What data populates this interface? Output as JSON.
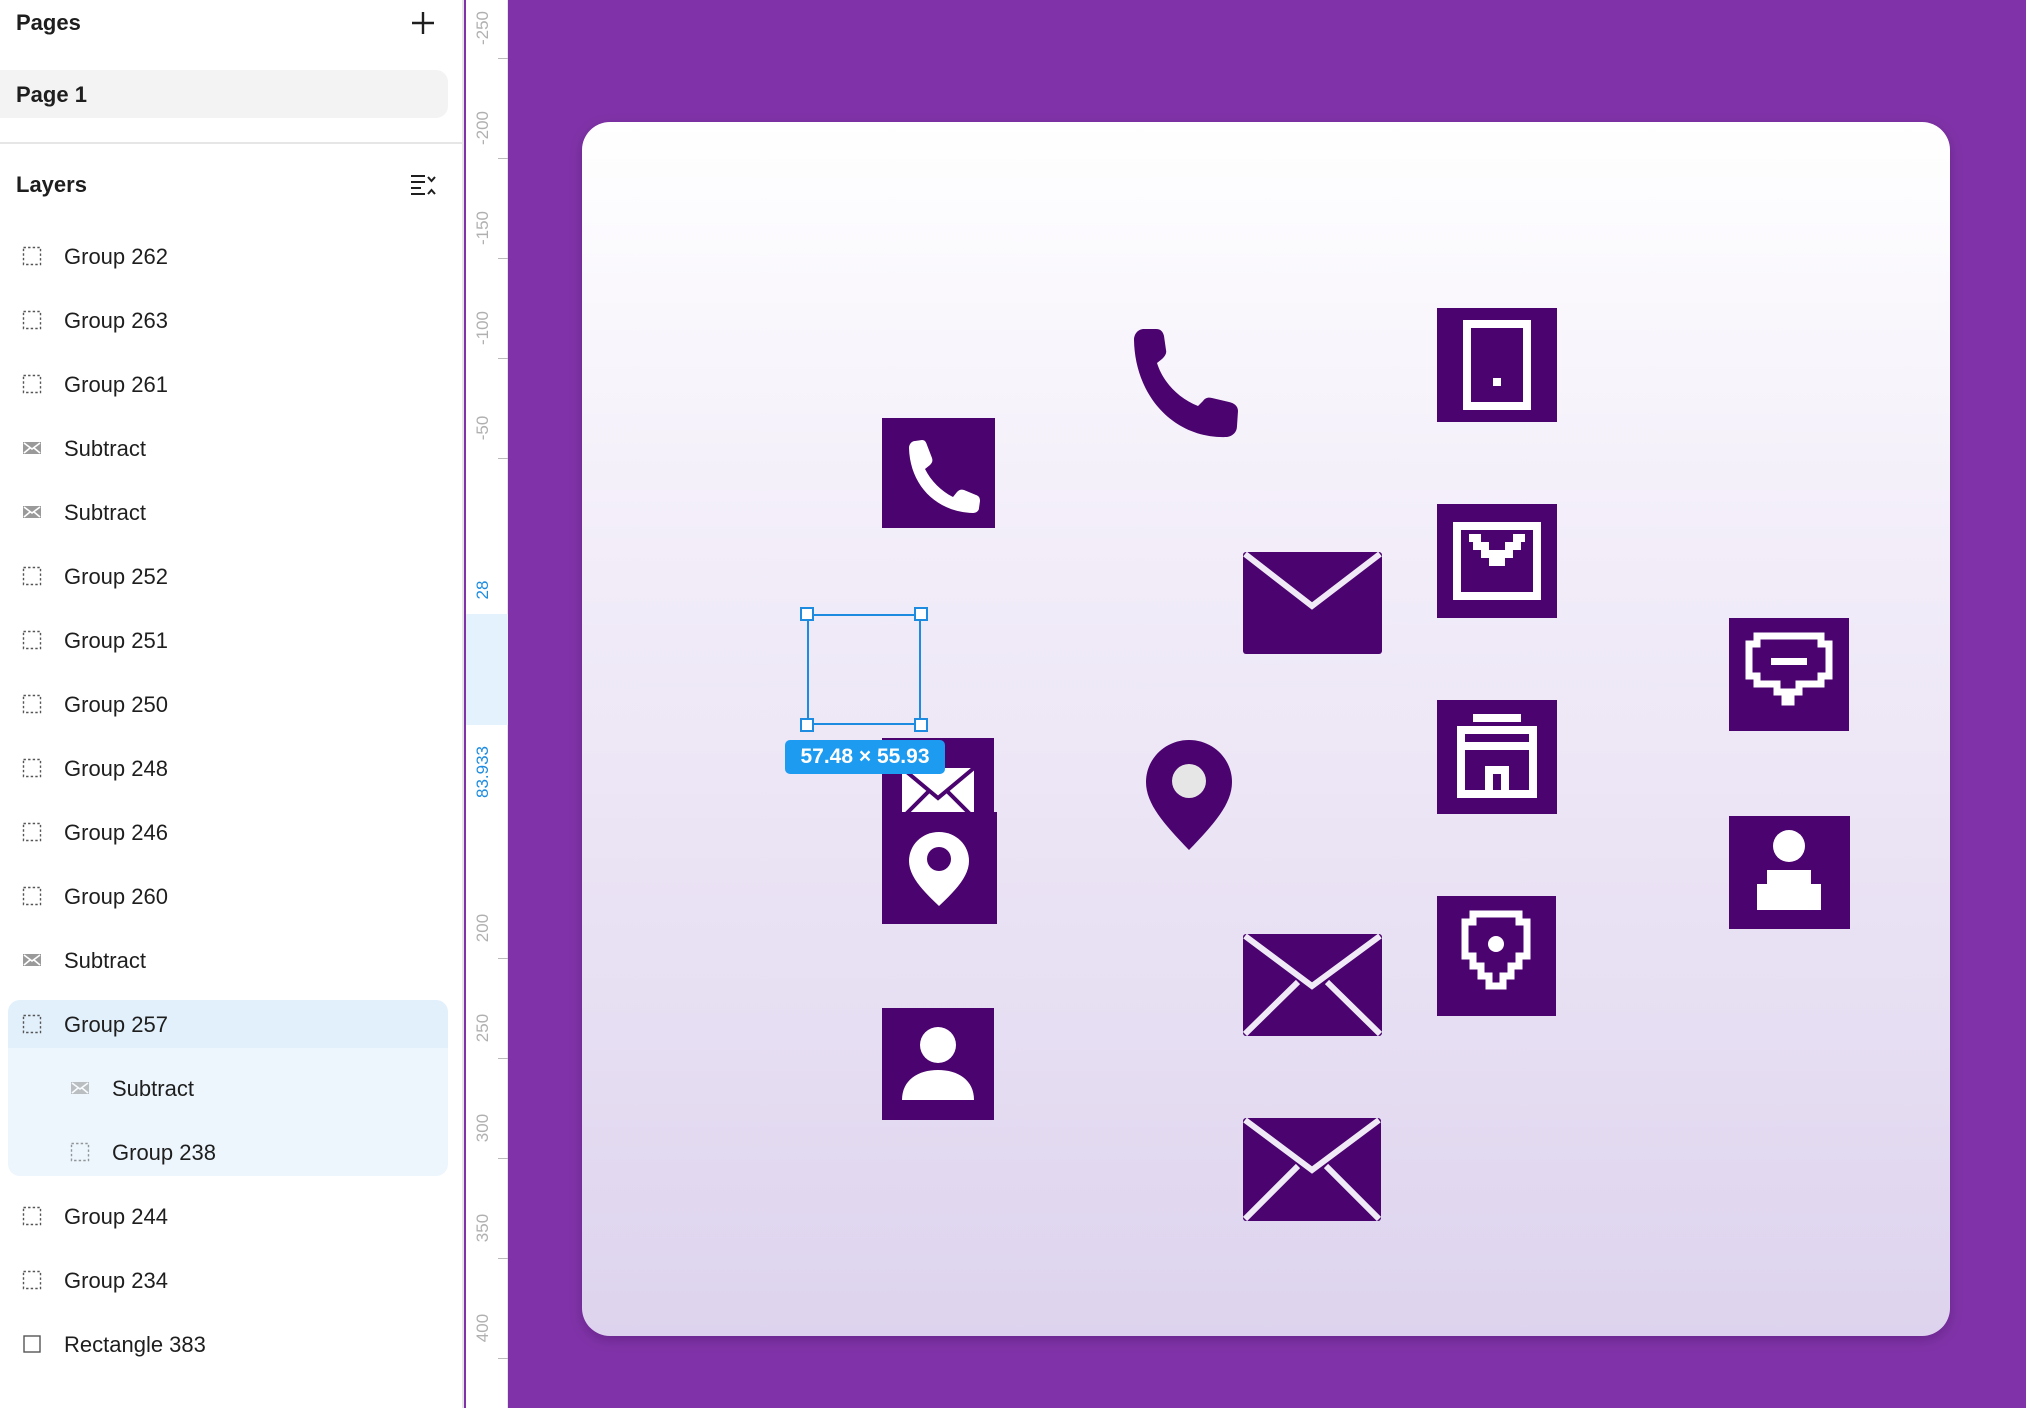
{
  "pages": {
    "title": "Pages",
    "items": [
      {
        "label": "Page 1",
        "selected": true
      }
    ]
  },
  "layers": {
    "title": "Layers",
    "items": [
      {
        "label": "Group 262",
        "icon": "group-icon",
        "level": 0
      },
      {
        "label": "Group 263",
        "icon": "group-icon",
        "level": 0
      },
      {
        "label": "Group 261",
        "icon": "group-icon",
        "level": 0
      },
      {
        "label": "Subtract",
        "icon": "subtract-icon",
        "level": 0
      },
      {
        "label": "Subtract",
        "icon": "subtract-icon",
        "level": 0
      },
      {
        "label": "Group 252",
        "icon": "group-icon",
        "level": 0
      },
      {
        "label": "Group 251",
        "icon": "group-icon",
        "level": 0
      },
      {
        "label": "Group 250",
        "icon": "group-icon",
        "level": 0
      },
      {
        "label": "Group 248",
        "icon": "group-icon",
        "level": 0
      },
      {
        "label": "Group 246",
        "icon": "group-icon",
        "level": 0
      },
      {
        "label": "Group 260",
        "icon": "group-icon",
        "level": 0
      },
      {
        "label": "Subtract",
        "icon": "subtract-icon",
        "level": 0
      },
      {
        "label": "Group 257",
        "icon": "group-icon",
        "level": 0,
        "selected": true
      },
      {
        "label": "Subtract",
        "icon": "subtract-icon",
        "level": 1
      },
      {
        "label": "Group 238",
        "icon": "group-icon",
        "level": 1
      },
      {
        "label": "Group 244",
        "icon": "group-icon",
        "level": 0
      },
      {
        "label": "Group 234",
        "icon": "group-icon",
        "level": 0
      },
      {
        "label": "Rectangle 383",
        "icon": "rectangle-icon",
        "level": 0
      }
    ]
  },
  "ruler": {
    "labels": [
      "-250",
      "-200",
      "-150",
      "-100",
      "-50",
      "28",
      "83.933",
      "200",
      "250",
      "300",
      "350",
      "400"
    ]
  },
  "selection": {
    "size_label": "57.48 × 55.93"
  },
  "colors": {
    "canvas_bg": "#8033a8",
    "icon_fill": "#4a036f",
    "accent": "#1d8ce0"
  }
}
